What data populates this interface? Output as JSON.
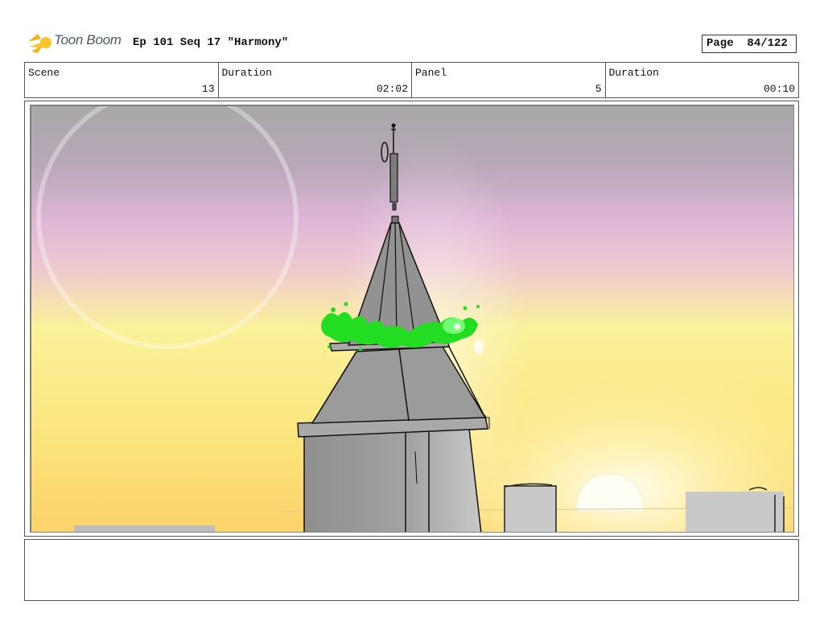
{
  "header": {
    "logo_text": "Toon Boom",
    "title": "Ep 101 Seq 17 \"Harmony\"",
    "page_label": "Page",
    "page_value": "84/122"
  },
  "info": {
    "scene_label": "Scene",
    "scene_value": "13",
    "duration_label": "Duration",
    "duration_value": "02:02",
    "panel_label": "Panel",
    "panel_value": "5",
    "panel_duration_label": "Duration",
    "panel_duration_value": "00:10"
  },
  "notes": {
    "text": ""
  },
  "colors": {
    "sky_top": "#a6a6a6",
    "sky_mid": "#e0b8d8",
    "sky_low": "#fbf08c",
    "sky_bottom": "#fdd96a",
    "tower_gray": "#9a9a9a",
    "goo_green": "#22dd22",
    "sun": "#fffbe8"
  }
}
